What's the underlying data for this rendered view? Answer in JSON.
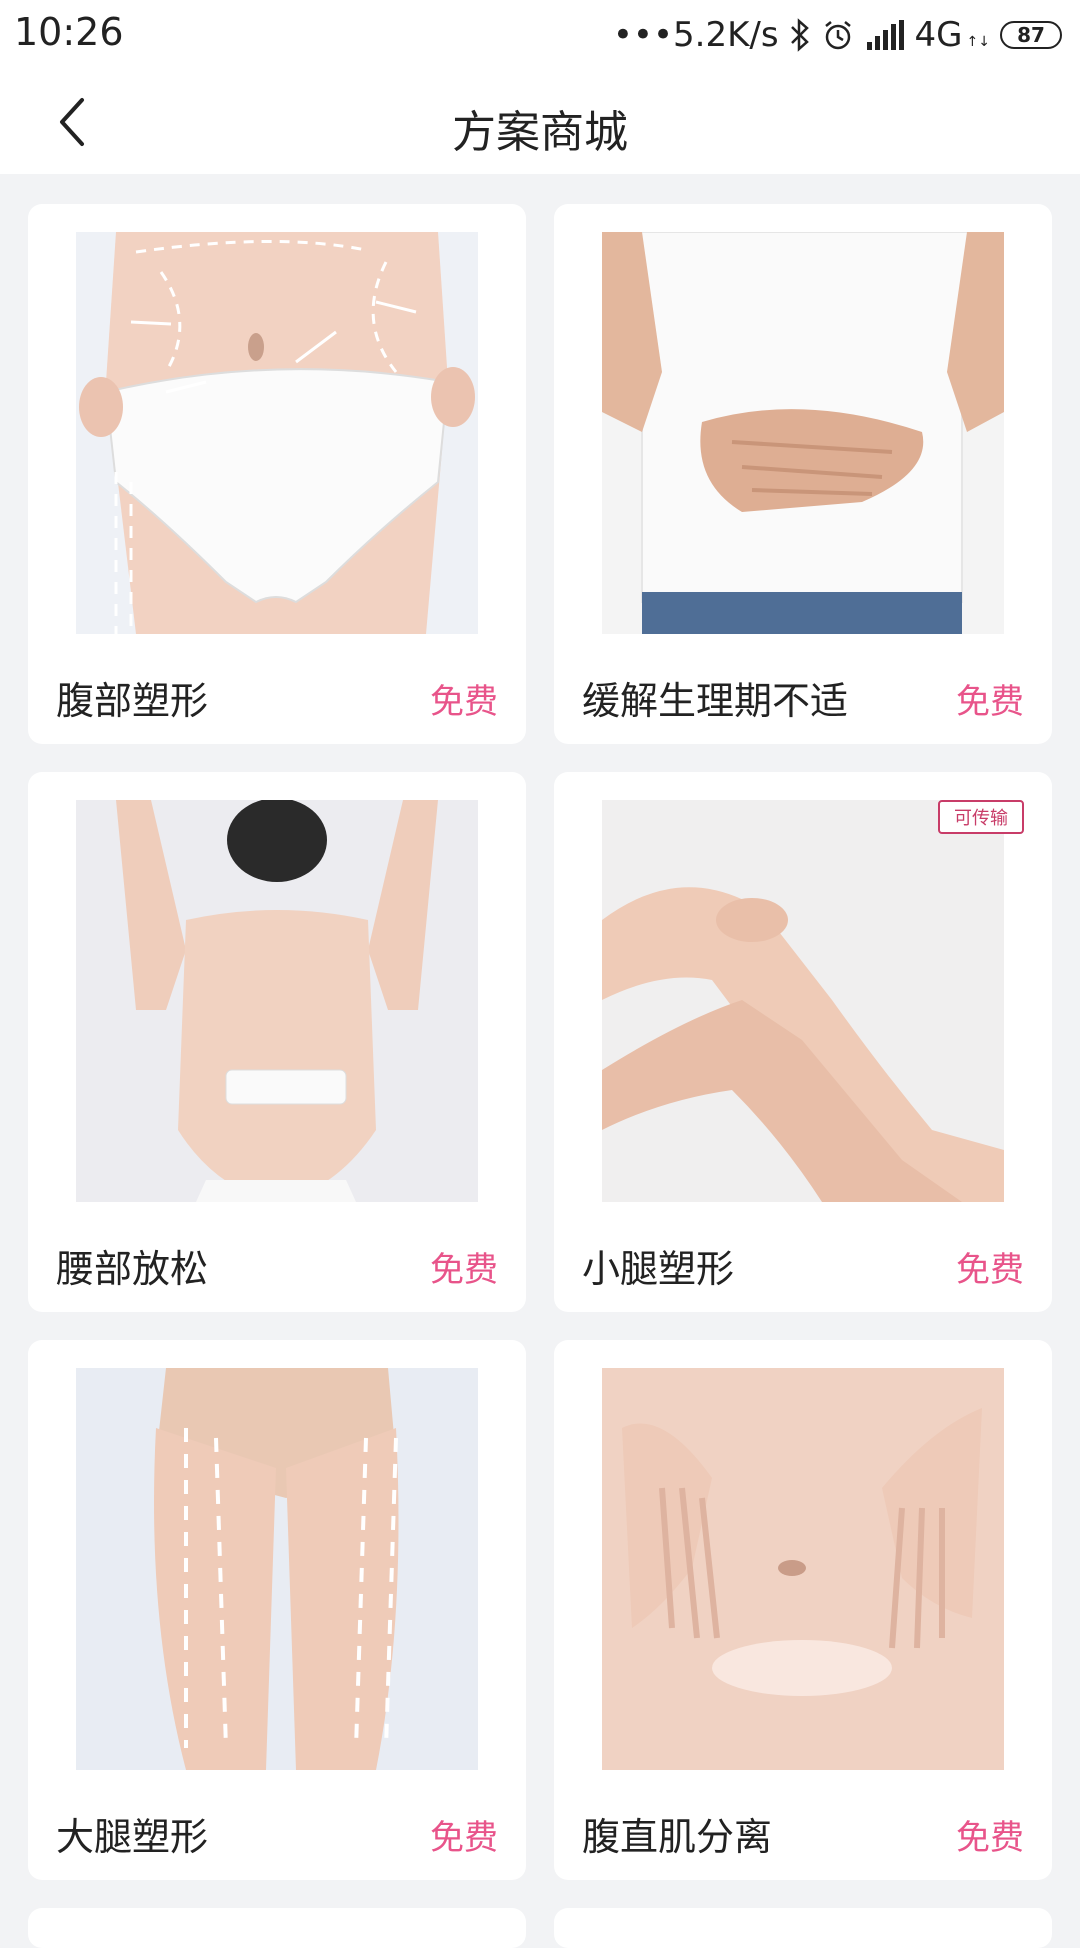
{
  "status_bar": {
    "time": "10:26",
    "network_speed": "•••5.2K/s",
    "network_type": "4G",
    "network_sub": "↑↓",
    "battery": "87",
    "icons": [
      "bluetooth-icon",
      "alarm-icon",
      "signal-icon"
    ]
  },
  "nav": {
    "title": "方案商城",
    "back_icon": "chevron-left-icon"
  },
  "colors": {
    "price": "#e8548a",
    "badge": "#c83c68",
    "background": "#f2f3f5"
  },
  "cards": [
    {
      "title": "腹部塑形",
      "price": "免费",
      "badge": "",
      "image": "abdomen-shaping-photo"
    },
    {
      "title": "缓解生理期不适",
      "price": "免费",
      "badge": "",
      "image": "period-relief-photo"
    },
    {
      "title": "腰部放松",
      "price": "免费",
      "badge": "",
      "image": "waist-relax-photo"
    },
    {
      "title": "小腿塑形",
      "price": "免费",
      "badge": "可传输",
      "image": "calf-shaping-photo"
    },
    {
      "title": "大腿塑形",
      "price": "免费",
      "badge": "",
      "image": "thigh-shaping-photo"
    },
    {
      "title": "腹直肌分离",
      "price": "免费",
      "badge": "",
      "image": "diastasis-recti-photo"
    }
  ]
}
